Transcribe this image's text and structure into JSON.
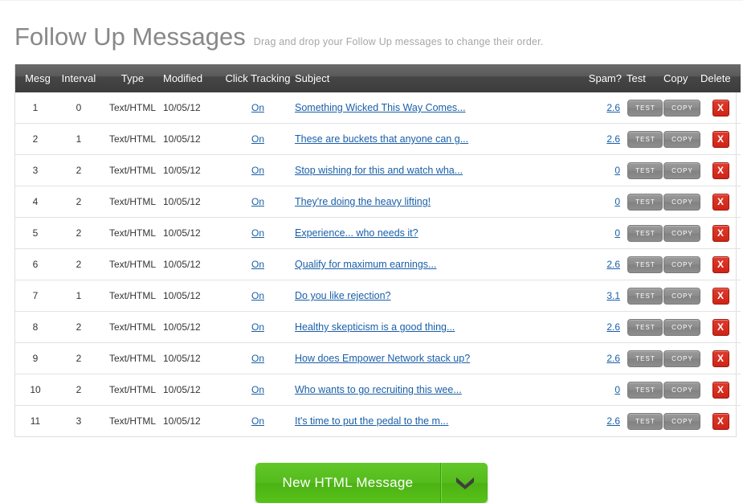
{
  "header": {
    "title": "Follow Up Messages",
    "subtitle": "Drag and drop your Follow Up messages to change their order."
  },
  "table": {
    "columns": [
      {
        "key": "mesg",
        "label": "Mesg"
      },
      {
        "key": "interval",
        "label": "Interval"
      },
      {
        "key": "type",
        "label": "Type"
      },
      {
        "key": "modified",
        "label": "Modified"
      },
      {
        "key": "click",
        "label": "Click Tracking"
      },
      {
        "key": "subject",
        "label": "Subject"
      },
      {
        "key": "spam",
        "label": "Spam?"
      },
      {
        "key": "test",
        "label": "Test"
      },
      {
        "key": "copy",
        "label": "Copy"
      },
      {
        "key": "delete",
        "label": "Delete"
      }
    ],
    "row_actions": {
      "test_label": "TEST",
      "copy_label": "COPY",
      "delete_label": "X"
    },
    "rows": [
      {
        "mesg": "1",
        "interval": "0",
        "type": "Text/HTML",
        "modified": "10/05/12",
        "click": "On",
        "subject": "Something Wicked This Way Comes...",
        "spam": "2.6"
      },
      {
        "mesg": "2",
        "interval": "1",
        "type": "Text/HTML",
        "modified": "10/05/12",
        "click": "On",
        "subject": "These are buckets that anyone can g...",
        "spam": "2.6"
      },
      {
        "mesg": "3",
        "interval": "2",
        "type": "Text/HTML",
        "modified": "10/05/12",
        "click": "On",
        "subject": "Stop wishing for this and watch wha...",
        "spam": "0"
      },
      {
        "mesg": "4",
        "interval": "2",
        "type": "Text/HTML",
        "modified": "10/05/12",
        "click": "On",
        "subject": "They're doing the heavy lifting!",
        "spam": "0"
      },
      {
        "mesg": "5",
        "interval": "2",
        "type": "Text/HTML",
        "modified": "10/05/12",
        "click": "On",
        "subject": "Experience... who needs it?",
        "spam": "0"
      },
      {
        "mesg": "6",
        "interval": "2",
        "type": "Text/HTML",
        "modified": "10/05/12",
        "click": "On",
        "subject": "Qualify for maximum earnings...",
        "spam": "2.6"
      },
      {
        "mesg": "7",
        "interval": "1",
        "type": "Text/HTML",
        "modified": "10/05/12",
        "click": "On",
        "subject": "Do you like rejection?",
        "spam": "3.1"
      },
      {
        "mesg": "8",
        "interval": "2",
        "type": "Text/HTML",
        "modified": "10/05/12",
        "click": "On",
        "subject": "Healthy skepticism is a good thing...",
        "spam": "2.6"
      },
      {
        "mesg": "9",
        "interval": "2",
        "type": "Text/HTML",
        "modified": "10/05/12",
        "click": "On",
        "subject": "How does Empower Network stack up?",
        "spam": "2.6"
      },
      {
        "mesg": "10",
        "interval": "2",
        "type": "Text/HTML",
        "modified": "10/05/12",
        "click": "On",
        "subject": "Who wants to go recruiting this wee...",
        "spam": "0"
      },
      {
        "mesg": "11",
        "interval": "3",
        "type": "Text/HTML",
        "modified": "10/05/12",
        "click": "On",
        "subject": "It's time to put the pedal to the m...",
        "spam": "2.6"
      }
    ]
  },
  "cta": {
    "label": "New HTML Message",
    "dropdown_icon": "chevron-down-icon"
  },
  "colors": {
    "link": "#1a5fa8",
    "header_bar": "#4a4a4a",
    "cta_green": "#54bb1c",
    "delete_red": "#d4281a",
    "title_gray": "#888888"
  }
}
